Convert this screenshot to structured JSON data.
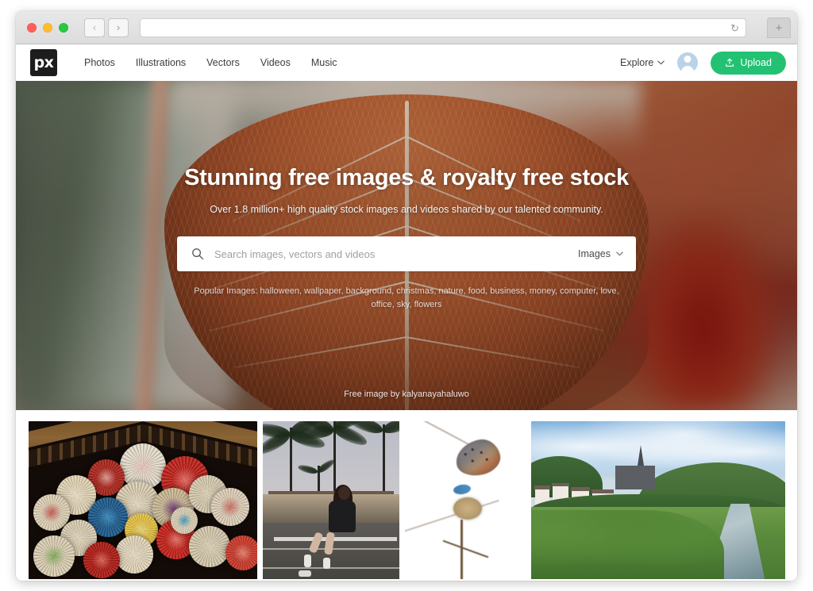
{
  "browser": {
    "traffic_lights": [
      "close",
      "minimize",
      "zoom"
    ],
    "back_label": "‹",
    "forward_label": "›",
    "address_value": "",
    "address_placeholder": "",
    "reload_label": "↻",
    "new_tab_label": "+"
  },
  "header": {
    "logo_text": "px",
    "nav": [
      {
        "label": "Photos"
      },
      {
        "label": "Illustrations"
      },
      {
        "label": "Vectors"
      },
      {
        "label": "Videos"
      },
      {
        "label": "Music"
      }
    ],
    "explore_label": "Explore",
    "explore_chevron": "⌄",
    "avatar_name": "user-avatar",
    "upload_label": "Upload",
    "upload_button_color": "#22c272"
  },
  "hero": {
    "title": "Stunning free images & royalty free stock",
    "subtitle": "Over 1.8 million+ high quality stock images and videos shared by our talented community.",
    "search": {
      "placeholder": "Search images, vectors and videos",
      "value": "",
      "type_label": "Images",
      "type_chevron": "⌄"
    },
    "popular_prefix": "Popular Images:",
    "popular_terms": "halloween, wallpaper, background, christmas, nature, food, business, money, computer, love, office, sky, flowers",
    "popular_full": "Popular Images: halloween, wallpaper, background, christmas, nature, food, business, money, computer, love, office, sky, flowers",
    "credit": "Free image by kalyanayahaluwo",
    "background_description": "Close-up of a backlit brown autumn leaf with pale veins, blurred sage green and deep red foliage behind"
  },
  "gallery": {
    "items": [
      {
        "name": "thumbnail-paper-parasols",
        "alt": "Colorful Asian paper parasols hanging under a wooden roof at night"
      },
      {
        "name": "thumbnail-skater-palms",
        "alt": "Woman in roller skates sitting on a bench with palm trees at dusk"
      },
      {
        "name": "thumbnail-butterfly",
        "alt": "Blue butterfly resting on a dried thistle flower"
      },
      {
        "name": "thumbnail-village-river",
        "alt": "German village with church spire beside a river and green hills"
      }
    ]
  },
  "colors": {
    "accent_green": "#22c272",
    "logo_background": "#1c1c1c",
    "chrome_background": "#e0e0e0"
  }
}
